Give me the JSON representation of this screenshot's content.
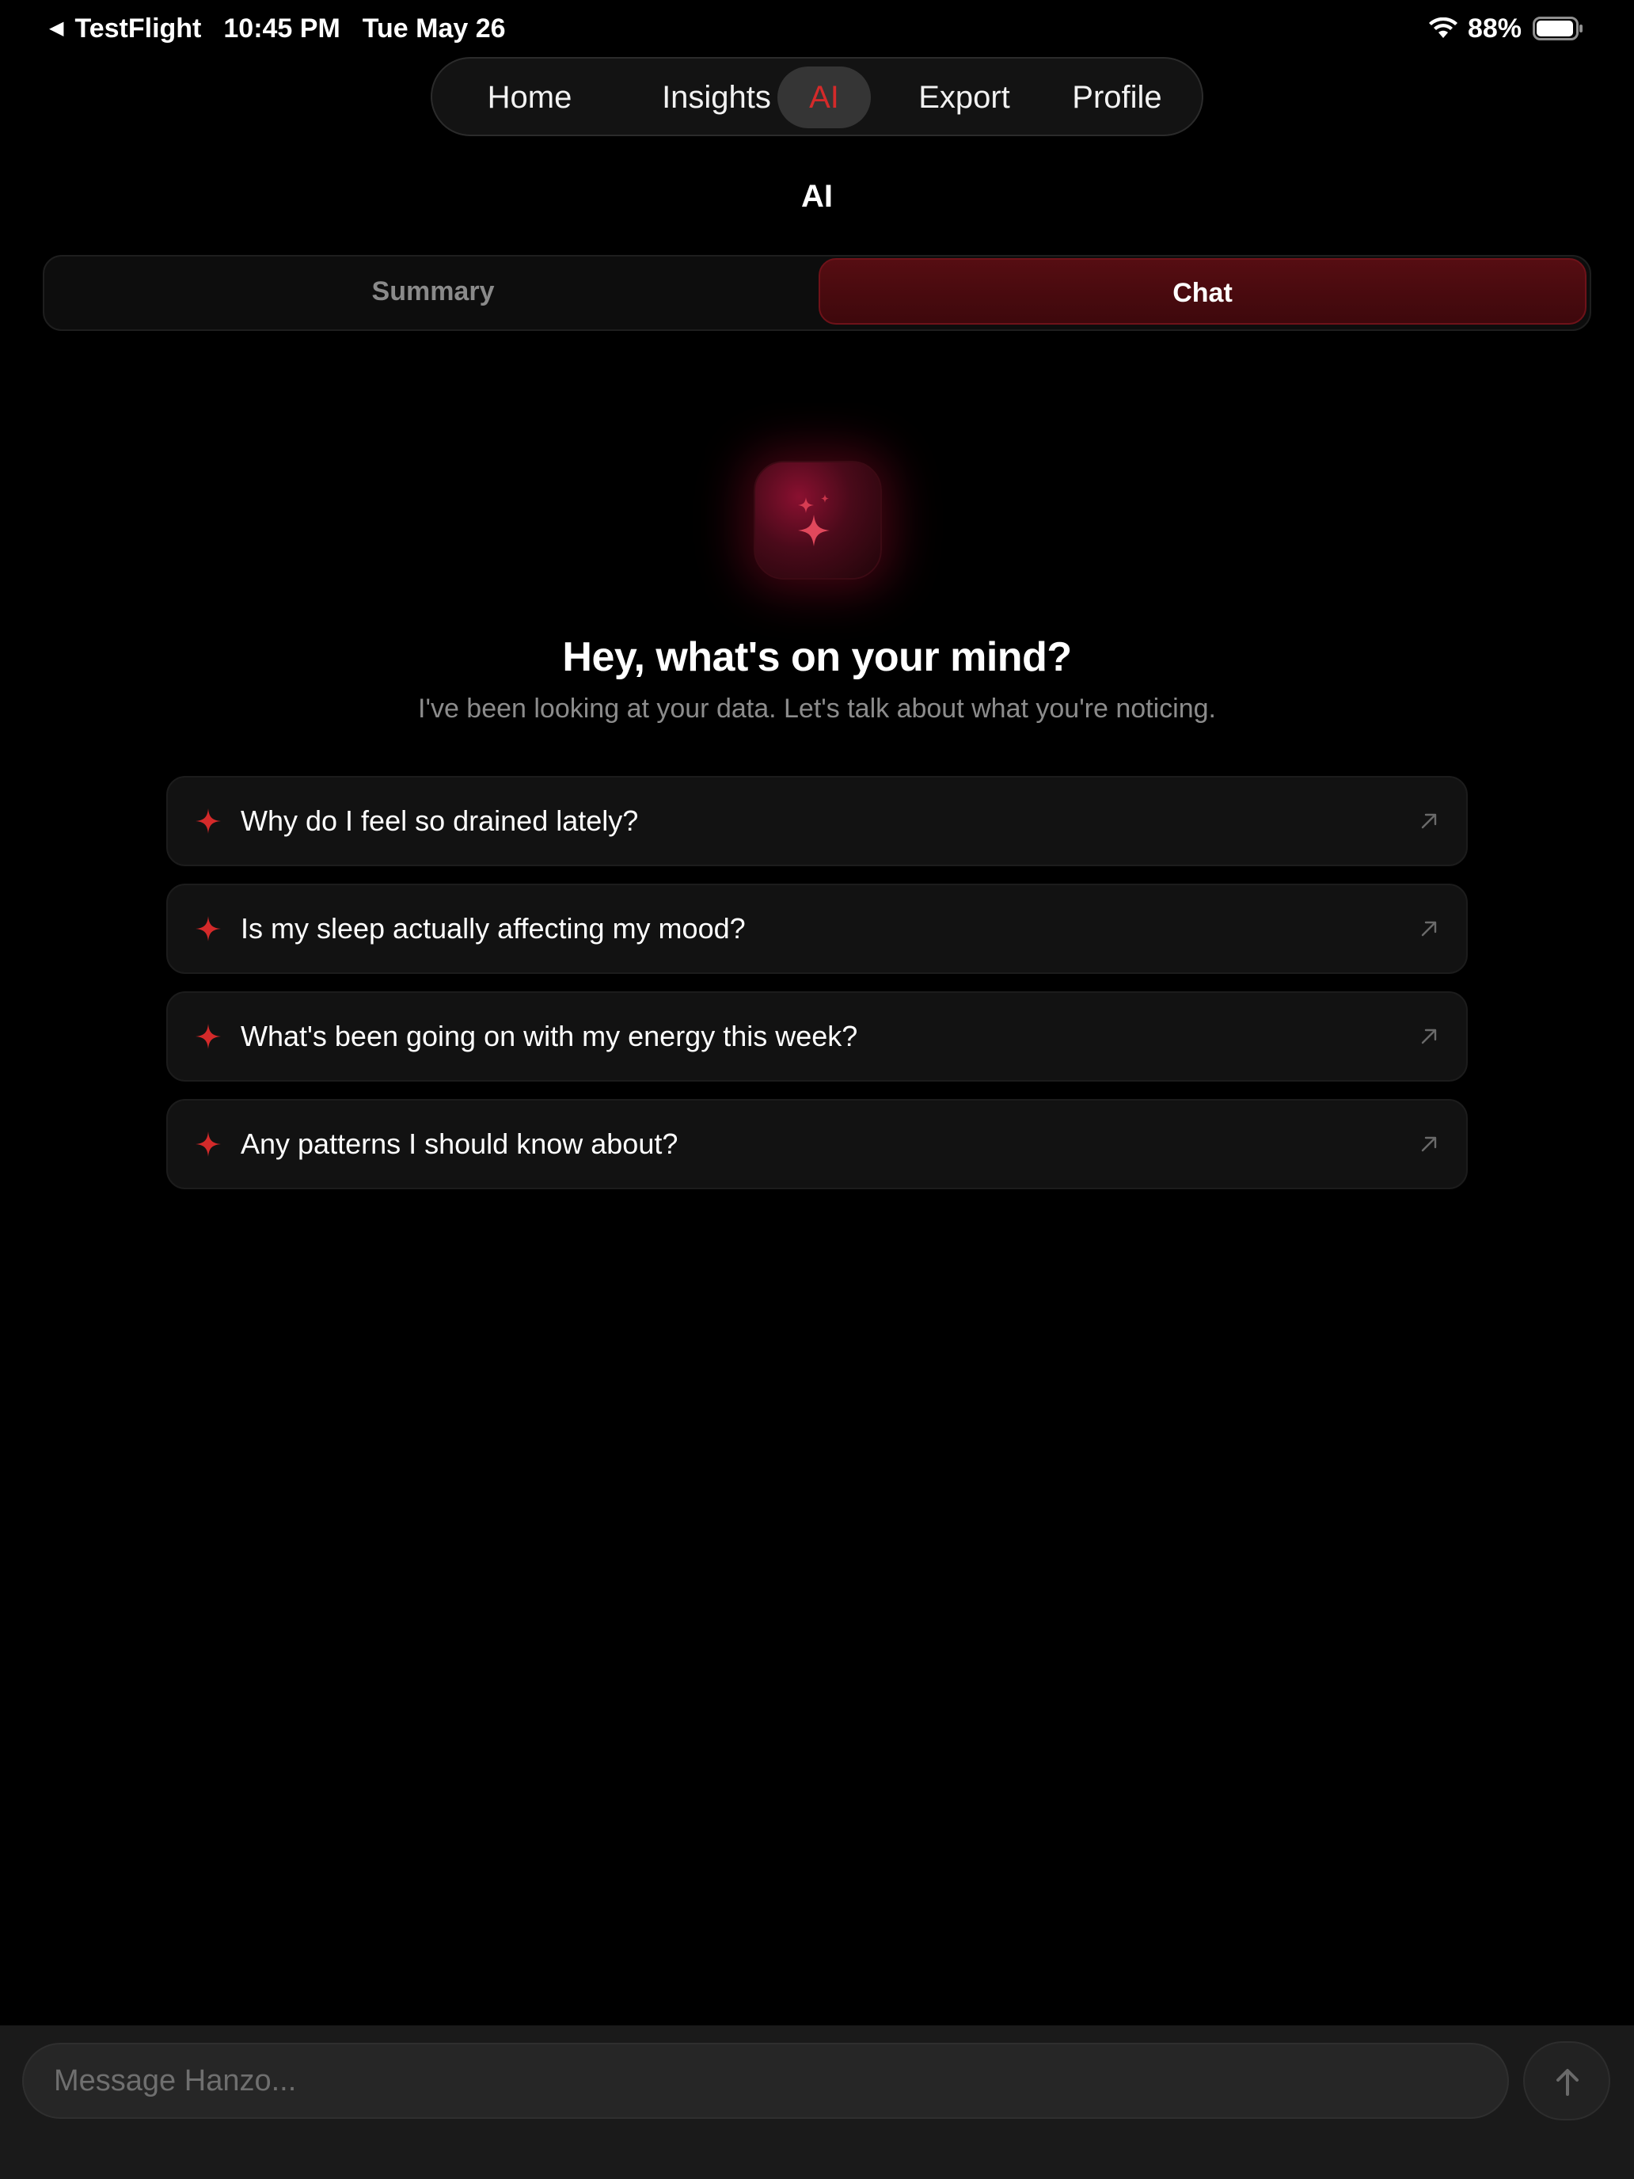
{
  "status_bar": {
    "app_name": "TestFlight",
    "time": "10:45 PM",
    "date": "Tue May 26",
    "battery_percent": "88%",
    "icons": [
      "back-arrow-icon",
      "wifi-icon",
      "battery-icon"
    ]
  },
  "nav": {
    "items": [
      {
        "label": "Home"
      },
      {
        "label": "Insights"
      },
      {
        "label": "AI"
      },
      {
        "label": "Export"
      },
      {
        "label": "Profile"
      }
    ],
    "active": "AI"
  },
  "page": {
    "title": "AI"
  },
  "segmented": {
    "tabs": [
      {
        "label": "Summary"
      },
      {
        "label": "Chat"
      }
    ],
    "active": "Chat"
  },
  "chat": {
    "icon": "sparkles-icon",
    "headline": "Hey, what's on your mind?",
    "subtitle": "I've been looking at your data. Let's talk about what you're noticing.",
    "suggestions": [
      {
        "text": "Why do I feel so drained lately?"
      },
      {
        "text": "Is my sleep actually affecting my mood?"
      },
      {
        "text": "What's been going on with my energy this week?"
      },
      {
        "text": "Any patterns I should know about?"
      }
    ]
  },
  "composer": {
    "placeholder": "Message Hanzo...",
    "value": "",
    "send_icon": "arrow-up-icon"
  },
  "colors": {
    "accent": "#d42a2a",
    "background": "#000000",
    "card": "#121212",
    "active_tab": "#4a0a0f"
  }
}
